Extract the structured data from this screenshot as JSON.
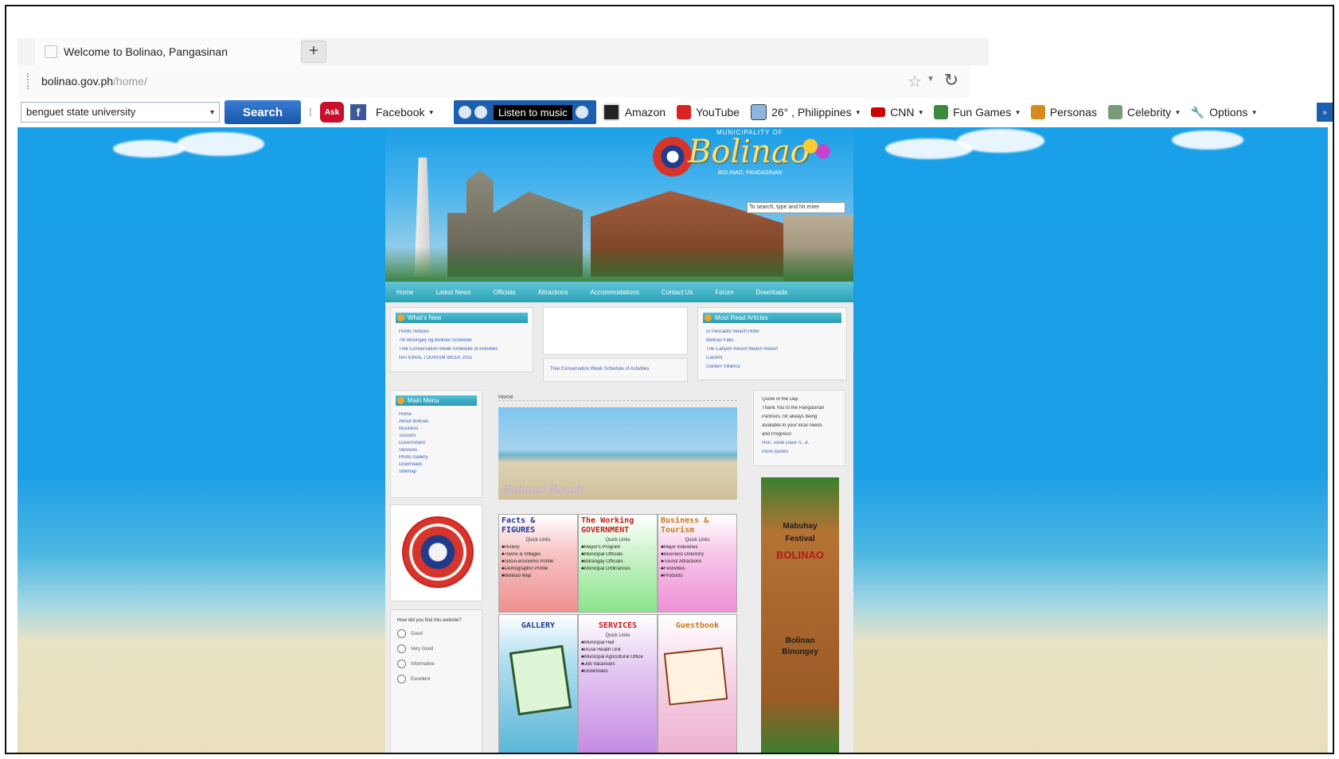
{
  "browser": {
    "tab": {
      "title": "Welcome to Bolinao, Pangasinan"
    },
    "new_tab_label": "+",
    "address": {
      "host": "bolinao.gov.ph",
      "path": "/home/"
    },
    "toolbar": {
      "search_value": "benguet state university",
      "search_button": "Search",
      "ask_label": "Ask",
      "facebook": "Facebook",
      "music": "Listen to music",
      "items": [
        "Amazon",
        "YouTube",
        "26° , Philippines",
        "CNN",
        "Fun Games",
        "Personas",
        "Celebrity",
        "Options"
      ]
    }
  },
  "site": {
    "municipality_label": "MUNICIPALITY OF",
    "logo_text": "Bolinao",
    "logo_sub": "BOLINAO, PANGASINAN",
    "search_placeholder": "To search, type and hit enter",
    "nav": [
      "Home",
      "Latest News",
      "Officials",
      "Attractions",
      "Accommodations",
      "Contact Us",
      "Forum",
      "Downloads"
    ],
    "whats_new": {
      "title": "What's New",
      "items": [
        "Public Notices",
        "7th Binungey ng Bolinao Schedule",
        "Tree Conservation Week Schedule of Activities",
        "NATIONAL TOURISM WEEK 2011"
      ]
    },
    "center_link": "Tree Conservation Week Schedule of Activities",
    "most_read": {
      "title": "Most Read Articles",
      "items": [
        "El Pescador Beach Hotel",
        "Bolinao Falls",
        "The Canyon Resort Beach Resort",
        "Caxomi",
        "Garden Villarica"
      ]
    },
    "main_menu": {
      "title": "Main Menu",
      "items": [
        "Home",
        "About Bolinao",
        "Business",
        "Tourism",
        "Government",
        "Services",
        "Photo Gallery",
        "Downloads",
        "Sitemap"
      ]
    },
    "breadcrumb": "Home",
    "photo_caption": "Bolinao Beach",
    "quote": {
      "lines": [
        "Quote of the Day",
        "Thank You to the Pangasinan",
        "Partners, for always being",
        "available to your local needs",
        "and Progress!",
        "Hon. Jovie Dave S. Jr."
      ],
      "more": "more quotes"
    },
    "tiles": [
      {
        "title1": "Facts & ",
        "title2": "FIGURES",
        "sub": "Quick Links",
        "items": [
          "History",
          "Towns & Villages",
          "Socio-economic Profile",
          "Demographic Profile",
          "Bolinao Map"
        ]
      },
      {
        "title1": "The Working",
        "title2": "GOVERNMENT",
        "sub": "Quick Links",
        "items": [
          "Mayor's Program",
          "Municipal Officials",
          "Barangay Officials",
          "Municipal Ordinances"
        ]
      },
      {
        "title1": "Business & ",
        "title2": "Tourism",
        "sub": "Quick Links",
        "items": [
          "Major Industries",
          "Business Directory",
          "Tourist Attractions",
          "Festivities",
          "Products"
        ]
      },
      {
        "title1": "GALLERY",
        "title2": "",
        "sub": "",
        "items": []
      },
      {
        "title1": "SERVICES",
        "title2": "",
        "sub": "Quick Links",
        "items": [
          "Municipal Hall",
          "Rural Health Unit",
          "Municipal Agricultural Office",
          "Job Vacancies",
          "Downloads"
        ]
      },
      {
        "title1": "Guestbook",
        "title2": "",
        "sub": "",
        "items": []
      }
    ],
    "poll": {
      "question": "How did you find this website?",
      "options": [
        "Good",
        "Very Good",
        "Informative",
        "Excellent"
      ]
    },
    "banner": {
      "lines": [
        "Mabuhay",
        "Festival",
        "BOLINAO",
        "Bolinao",
        "Binungey"
      ]
    }
  }
}
